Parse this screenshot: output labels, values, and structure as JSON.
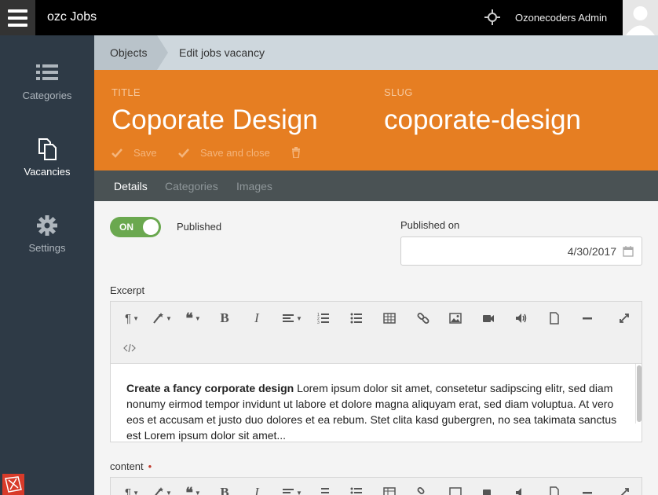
{
  "topbar": {
    "app_title": "ozc Jobs",
    "admin_name": "Ozonecoders Admin"
  },
  "sidebar": {
    "items": [
      {
        "label": "Categories",
        "icon": "list-icon",
        "active": false
      },
      {
        "label": "Vacancies",
        "icon": "copy-icon",
        "active": true
      },
      {
        "label": "Settings",
        "icon": "gear-icon",
        "active": false
      }
    ]
  },
  "breadcrumb": {
    "parent": "Objects",
    "current": "Edit jobs vacancy"
  },
  "header": {
    "title_label": "TITLE",
    "title_value": "Coporate Design",
    "slug_label": "SLUG",
    "slug_value": "coporate-design",
    "save_label": "Save",
    "save_close_label": "Save and close",
    "delete_icon": "trash-icon",
    "color": "#e67e22"
  },
  "tabs": [
    {
      "label": "Details",
      "active": true
    },
    {
      "label": "Categories",
      "active": false
    },
    {
      "label": "Images",
      "active": false
    }
  ],
  "form": {
    "published_toggle": "ON",
    "published_label": "Published",
    "published_on_label": "Published on",
    "published_on_value": "4/30/2017",
    "excerpt_label": "Excerpt",
    "excerpt_bold": "Create a fancy corporate design",
    "excerpt_text": " Lorem ipsum dolor sit amet, consetetur sadipscing elitr, sed diam nonumy eirmod tempor invidunt ut labore et dolore magna aliquyam erat, sed diam voluptua. At vero eos et accusam et justo duo dolores et ea rebum. Stet clita kasd gubergren, no sea takimata sanctus est Lorem ipsum dolor sit amet...",
    "content_label": "content",
    "content_required_mark": "•"
  },
  "toolbar_icons": [
    "paragraph-icon",
    "magic-icon",
    "quote-icon",
    "bold-icon",
    "italic-icon",
    "align-icon",
    "ordered-list-icon",
    "unordered-list-icon",
    "table-icon",
    "link-icon",
    "image-icon",
    "video-icon",
    "audio-icon",
    "file-icon",
    "hr-icon",
    "fullscreen-icon",
    "code-icon"
  ],
  "colors": {
    "accent": "#e67e22",
    "toggle_on": "#6aa84f",
    "sidebar_bg": "#2e3a46"
  }
}
